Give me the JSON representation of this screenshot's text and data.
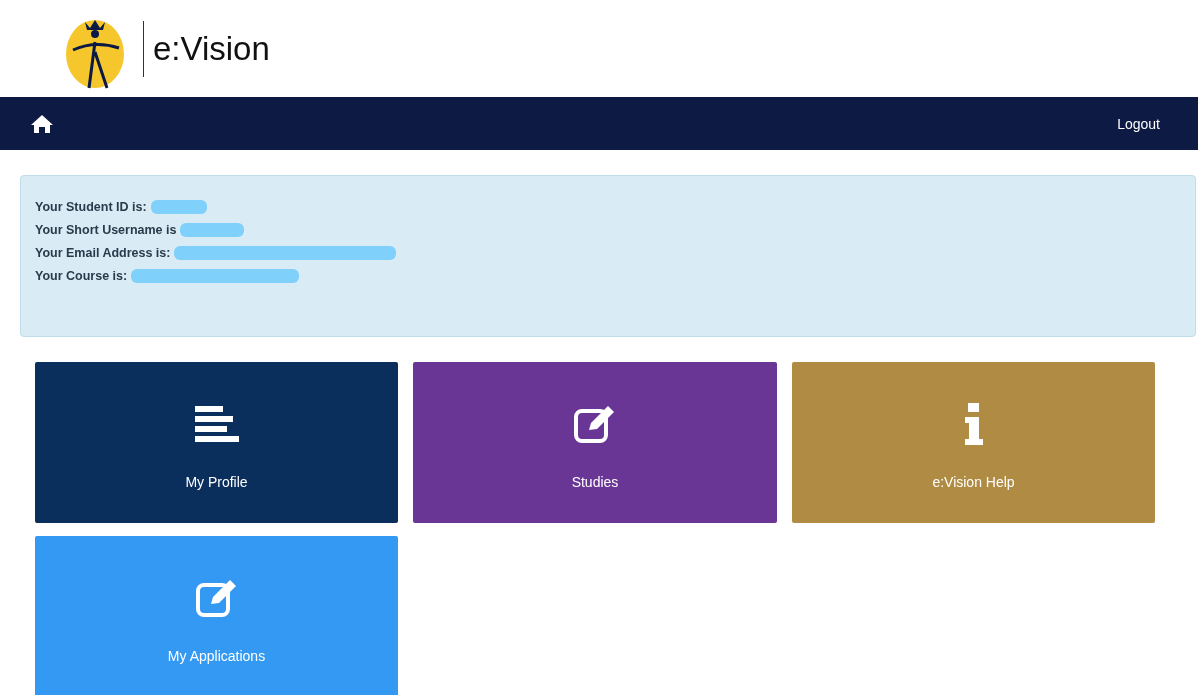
{
  "header": {
    "logo_text": "e:Vision"
  },
  "navbar": {
    "logout": "Logout"
  },
  "info": [
    {
      "label": "Your Student ID is:",
      "redacted": true
    },
    {
      "label": "Your Short Username is",
      "redacted": true
    },
    {
      "label": "Your Email Address is:",
      "redacted": true
    },
    {
      "label": "Your Course is:",
      "redacted": true
    }
  ],
  "tiles": [
    {
      "label": "My Profile",
      "kind": "lines",
      "color": "#0b2f5c"
    },
    {
      "label": "Studies",
      "kind": "edit",
      "color": "#693696"
    },
    {
      "label": "e:Vision Help",
      "kind": "info",
      "color": "#b08b43"
    },
    {
      "label": "My Applications",
      "kind": "edit",
      "color": "#3399f3"
    }
  ]
}
